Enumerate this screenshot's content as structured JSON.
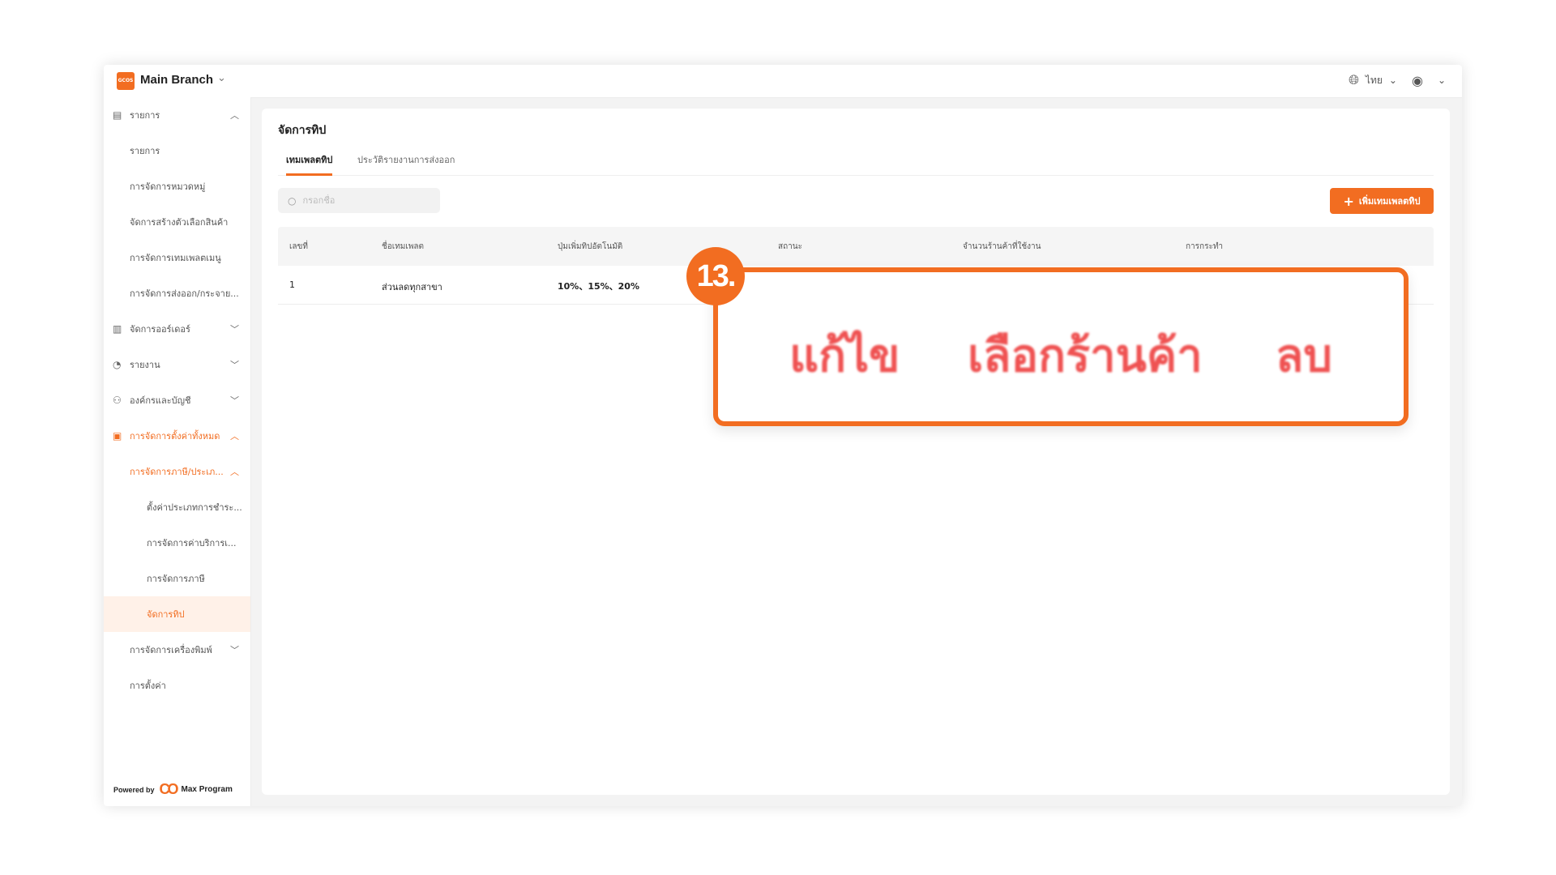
{
  "header": {
    "logo_text": "GCOS",
    "branch": "Main Branch",
    "language": "ไทย"
  },
  "sidebar": {
    "items": [
      {
        "label": "รายการ",
        "icon": "list-icon"
      },
      {
        "label": "รายการ"
      },
      {
        "label": "การจัดการหมวดหมู่"
      },
      {
        "label": "จัดการสร้างตัวเลือกสินค้า"
      },
      {
        "label": "การจัดการเทมเพลตเมนู"
      },
      {
        "label": "การจัดการส่งออก/กระจาย..."
      },
      {
        "label": "จัดการออร์เดอร์",
        "icon": "order-icon"
      },
      {
        "label": "รายงาน",
        "icon": "report-icon"
      },
      {
        "label": "องค์กรและบัญชี",
        "icon": "org-icon"
      },
      {
        "label": "การจัดการตั้งค่าทั้งหมด",
        "icon": "settings-icon"
      },
      {
        "label": "การจัดการภาษี/ประเภ..."
      },
      {
        "label": "ตั้งค่าประเภทการชำระ..."
      },
      {
        "label": "การจัดการค่าบริการเ..."
      },
      {
        "label": "การจัดการภาษี"
      },
      {
        "label": "จัดการทิป"
      },
      {
        "label": "การจัดการเครื่องพิมพ์"
      },
      {
        "label": "การตั้งค่า"
      }
    ],
    "powered_by": "Powered by",
    "brand_small": "Max Program"
  },
  "page": {
    "title": "จัดการทิป",
    "tabs": [
      "เทมเพลตทิป",
      "ประวัติรายงานการส่งออก"
    ],
    "search_placeholder": "กรอกชื่อ",
    "add_button": "เพิ่มเทมเพลตทิป"
  },
  "table": {
    "columns": [
      "เลขที่",
      "ชื่อเทมเพลต",
      "ปุ่มเพิ่มทิปอัตโนมัติ",
      "สถานะ",
      "จำนวนร้านค้าที่ใช้งาน",
      "การกระทำ"
    ],
    "rows": [
      [
        "1",
        "ส่วนลดทุกสาขา",
        "10%、15%、20%"
      ]
    ]
  },
  "callout": {
    "badge": "13.",
    "actions": [
      "แก้ไข",
      "เลือกร้านค้า",
      "ลบ"
    ]
  },
  "colors": {
    "accent": "#f26d21",
    "callout_text": "#ef5252"
  }
}
